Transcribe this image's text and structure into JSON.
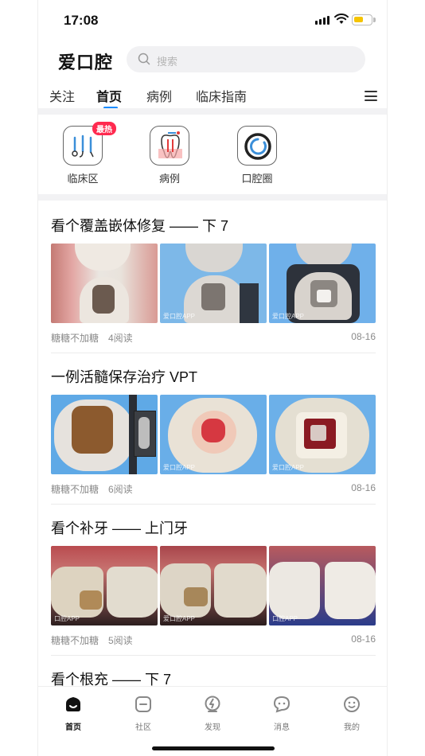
{
  "status_bar": {
    "time": "17:08"
  },
  "header": {
    "logo": "爱口腔",
    "search_placeholder": "搜索"
  },
  "tabs": [
    {
      "label": "关注"
    },
    {
      "label": "首页",
      "active": true
    },
    {
      "label": "病例"
    },
    {
      "label": "临床指南"
    }
  ],
  "quick_entries": [
    {
      "label": "临床区",
      "badge": "最热",
      "icon": "dental-tools-icon"
    },
    {
      "label": "病例",
      "icon": "tooth-icon"
    },
    {
      "label": "口腔圈",
      "icon": "circle-icon"
    }
  ],
  "articles": [
    {
      "title": "看个覆盖嵌体修复 —— 下 7",
      "author": "糖糖不加糖",
      "reads": "4阅读",
      "date": "08-16"
    },
    {
      "title": "一例活髓保存治疗 VPT",
      "author": "糖糖不加糖",
      "reads": "6阅读",
      "date": "08-16"
    },
    {
      "title": "看个补牙 —— 上门牙",
      "author": "糖糖不加糖",
      "reads": "5阅读",
      "date": "08-16"
    },
    {
      "title": "看个根充 —— 下 7"
    }
  ],
  "bottom_nav": [
    {
      "label": "首页",
      "icon": "home-icon",
      "active": true
    },
    {
      "label": "社区",
      "icon": "community-icon"
    },
    {
      "label": "发现",
      "icon": "discover-icon"
    },
    {
      "label": "消息",
      "icon": "message-icon"
    },
    {
      "label": "我的",
      "icon": "profile-icon"
    }
  ],
  "colors": {
    "accent": "#1a8cff",
    "badge": "#ff2a4f",
    "battery": "#f5c400"
  }
}
